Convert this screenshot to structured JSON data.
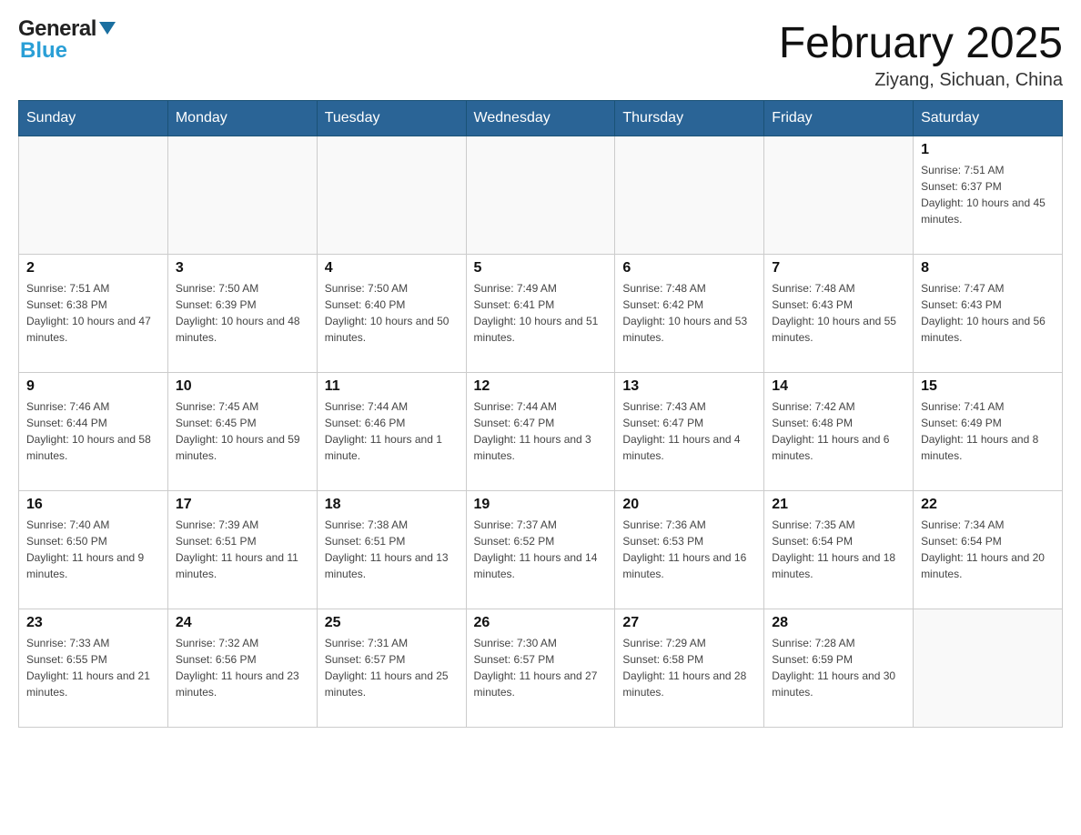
{
  "header": {
    "logo": {
      "general": "General",
      "blue": "Blue"
    },
    "title": "February 2025",
    "location": "Ziyang, Sichuan, China"
  },
  "days_of_week": [
    "Sunday",
    "Monday",
    "Tuesday",
    "Wednesday",
    "Thursday",
    "Friday",
    "Saturday"
  ],
  "weeks": [
    [
      {
        "day": "",
        "sunrise": "",
        "sunset": "",
        "daylight": ""
      },
      {
        "day": "",
        "sunrise": "",
        "sunset": "",
        "daylight": ""
      },
      {
        "day": "",
        "sunrise": "",
        "sunset": "",
        "daylight": ""
      },
      {
        "day": "",
        "sunrise": "",
        "sunset": "",
        "daylight": ""
      },
      {
        "day": "",
        "sunrise": "",
        "sunset": "",
        "daylight": ""
      },
      {
        "day": "",
        "sunrise": "",
        "sunset": "",
        "daylight": ""
      },
      {
        "day": "1",
        "sunrise": "Sunrise: 7:51 AM",
        "sunset": "Sunset: 6:37 PM",
        "daylight": "Daylight: 10 hours and 45 minutes."
      }
    ],
    [
      {
        "day": "2",
        "sunrise": "Sunrise: 7:51 AM",
        "sunset": "Sunset: 6:38 PM",
        "daylight": "Daylight: 10 hours and 47 minutes."
      },
      {
        "day": "3",
        "sunrise": "Sunrise: 7:50 AM",
        "sunset": "Sunset: 6:39 PM",
        "daylight": "Daylight: 10 hours and 48 minutes."
      },
      {
        "day": "4",
        "sunrise": "Sunrise: 7:50 AM",
        "sunset": "Sunset: 6:40 PM",
        "daylight": "Daylight: 10 hours and 50 minutes."
      },
      {
        "day": "5",
        "sunrise": "Sunrise: 7:49 AM",
        "sunset": "Sunset: 6:41 PM",
        "daylight": "Daylight: 10 hours and 51 minutes."
      },
      {
        "day": "6",
        "sunrise": "Sunrise: 7:48 AM",
        "sunset": "Sunset: 6:42 PM",
        "daylight": "Daylight: 10 hours and 53 minutes."
      },
      {
        "day": "7",
        "sunrise": "Sunrise: 7:48 AM",
        "sunset": "Sunset: 6:43 PM",
        "daylight": "Daylight: 10 hours and 55 minutes."
      },
      {
        "day": "8",
        "sunrise": "Sunrise: 7:47 AM",
        "sunset": "Sunset: 6:43 PM",
        "daylight": "Daylight: 10 hours and 56 minutes."
      }
    ],
    [
      {
        "day": "9",
        "sunrise": "Sunrise: 7:46 AM",
        "sunset": "Sunset: 6:44 PM",
        "daylight": "Daylight: 10 hours and 58 minutes."
      },
      {
        "day": "10",
        "sunrise": "Sunrise: 7:45 AM",
        "sunset": "Sunset: 6:45 PM",
        "daylight": "Daylight: 10 hours and 59 minutes."
      },
      {
        "day": "11",
        "sunrise": "Sunrise: 7:44 AM",
        "sunset": "Sunset: 6:46 PM",
        "predetermined": "Daylight: 11 hours and 1 minute."
      },
      {
        "day": "12",
        "sunrise": "Sunrise: 7:44 AM",
        "sunset": "Sunset: 6:47 PM",
        "daylight": "Daylight: 11 hours and 3 minutes."
      },
      {
        "day": "13",
        "sunrise": "Sunrise: 7:43 AM",
        "sunset": "Sunset: 6:47 PM",
        "daylight": "Daylight: 11 hours and 4 minutes."
      },
      {
        "day": "14",
        "sunrise": "Sunrise: 7:42 AM",
        "sunset": "Sunset: 6:48 PM",
        "daylight": "Daylight: 11 hours and 6 minutes."
      },
      {
        "day": "15",
        "sunrise": "Sunrise: 7:41 AM",
        "sunset": "Sunset: 6:49 PM",
        "daylight": "Daylight: 11 hours and 8 minutes."
      }
    ],
    [
      {
        "day": "16",
        "sunrise": "Sunrise: 7:40 AM",
        "sunset": "Sunset: 6:50 PM",
        "daylight": "Daylight: 11 hours and 9 minutes."
      },
      {
        "day": "17",
        "sunrise": "Sunrise: 7:39 AM",
        "sunset": "Sunset: 6:51 PM",
        "daylight": "Daylight: 11 hours and 11 minutes."
      },
      {
        "day": "18",
        "sunrise": "Sunrise: 7:38 AM",
        "sunset": "Sunset: 6:51 PM",
        "daylight": "Daylight: 11 hours and 13 minutes."
      },
      {
        "day": "19",
        "sunrise": "Sunrise: 7:37 AM",
        "sunset": "Sunset: 6:52 PM",
        "daylight": "Daylight: 11 hours and 14 minutes."
      },
      {
        "day": "20",
        "sunrise": "Sunrise: 7:36 AM",
        "sunset": "Sunset: 6:53 PM",
        "daylight": "Daylight: 11 hours and 16 minutes."
      },
      {
        "day": "21",
        "sunrise": "Sunrise: 7:35 AM",
        "sunset": "Sunset: 6:54 PM",
        "daylight": "Daylight: 11 hours and 18 minutes."
      },
      {
        "day": "22",
        "sunrise": "Sunrise: 7:34 AM",
        "sunset": "Sunset: 6:54 PM",
        "daylight": "Daylight: 11 hours and 20 minutes."
      }
    ],
    [
      {
        "day": "23",
        "sunrise": "Sunrise: 7:33 AM",
        "sunset": "Sunset: 6:55 PM",
        "daylight": "Daylight: 11 hours and 21 minutes."
      },
      {
        "day": "24",
        "sunrise": "Sunrise: 7:32 AM",
        "sunset": "Sunset: 6:56 PM",
        "daylight": "Daylight: 11 hours and 23 minutes."
      },
      {
        "day": "25",
        "sunrise": "Sunrise: 7:31 AM",
        "sunset": "Sunset: 6:57 PM",
        "daylight": "Daylight: 11 hours and 25 minutes."
      },
      {
        "day": "26",
        "sunrise": "Sunrise: 7:30 AM",
        "sunset": "Sunset: 6:57 PM",
        "daylight": "Daylight: 11 hours and 27 minutes."
      },
      {
        "day": "27",
        "sunrise": "Sunrise: 7:29 AM",
        "sunset": "Sunset: 6:58 PM",
        "daylight": "Daylight: 11 hours and 28 minutes."
      },
      {
        "day": "28",
        "sunrise": "Sunrise: 7:28 AM",
        "sunset": "Sunset: 6:59 PM",
        "daylight": "Daylight: 11 hours and 30 minutes."
      },
      {
        "day": "",
        "sunrise": "",
        "sunset": "",
        "daylight": ""
      }
    ]
  ],
  "week11_day11_daylight": "Daylight: 11 hours and 1 minute."
}
